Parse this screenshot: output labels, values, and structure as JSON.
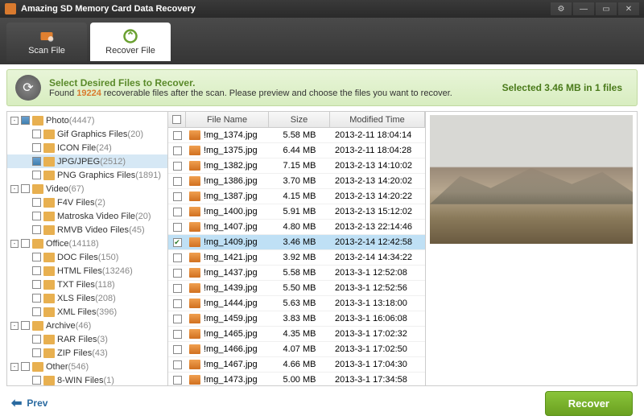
{
  "title": "Amazing SD Memory Card Data Recovery",
  "toolbar": {
    "scan": "Scan File",
    "recover": "Recover File"
  },
  "info": {
    "title": "Select Desired Files to Recover.",
    "found_prefix": "Found ",
    "found_count": "19224",
    "found_suffix": " recoverable files after the scan. Please preview and choose the files you want to recover.",
    "selected": "Selected 3.46 MB in 1 files"
  },
  "tree": [
    {
      "d": 0,
      "exp": "-",
      "chk": "some",
      "label": "Photo",
      "count": "(4447)"
    },
    {
      "d": 1,
      "exp": "",
      "chk": "",
      "label": "Gif Graphics Files",
      "count": "(20)"
    },
    {
      "d": 1,
      "exp": "",
      "chk": "",
      "label": "ICON File",
      "count": "(24)"
    },
    {
      "d": 1,
      "exp": "",
      "chk": "some",
      "label": "JPG/JPEG",
      "count": "(2512)",
      "sel": true
    },
    {
      "d": 1,
      "exp": "",
      "chk": "",
      "label": "PNG Graphics Files",
      "count": "(1891)"
    },
    {
      "d": 0,
      "exp": "-",
      "chk": "",
      "label": "Video",
      "count": "(67)"
    },
    {
      "d": 1,
      "exp": "",
      "chk": "",
      "label": "F4V Files",
      "count": "(2)"
    },
    {
      "d": 1,
      "exp": "",
      "chk": "",
      "label": "Matroska Video File",
      "count": "(20)"
    },
    {
      "d": 1,
      "exp": "",
      "chk": "",
      "label": "RMVB Video Files",
      "count": "(45)"
    },
    {
      "d": 0,
      "exp": "-",
      "chk": "",
      "label": "Office",
      "count": "(14118)"
    },
    {
      "d": 1,
      "exp": "",
      "chk": "",
      "label": "DOC Files",
      "count": "(150)"
    },
    {
      "d": 1,
      "exp": "",
      "chk": "",
      "label": "HTML Files",
      "count": "(13246)"
    },
    {
      "d": 1,
      "exp": "",
      "chk": "",
      "label": "TXT Files",
      "count": "(118)"
    },
    {
      "d": 1,
      "exp": "",
      "chk": "",
      "label": "XLS Files",
      "count": "(208)"
    },
    {
      "d": 1,
      "exp": "",
      "chk": "",
      "label": "XML Files",
      "count": "(396)"
    },
    {
      "d": 0,
      "exp": "-",
      "chk": "",
      "label": "Archive",
      "count": "(46)"
    },
    {
      "d": 1,
      "exp": "",
      "chk": "",
      "label": "RAR Files",
      "count": "(3)"
    },
    {
      "d": 1,
      "exp": "",
      "chk": "",
      "label": "ZIP Files",
      "count": "(43)"
    },
    {
      "d": 0,
      "exp": "-",
      "chk": "",
      "label": "Other",
      "count": "(546)"
    },
    {
      "d": 1,
      "exp": "",
      "chk": "",
      "label": "8-WIN Files",
      "count": "(1)"
    }
  ],
  "grid": {
    "headers": {
      "name": "File Name",
      "size": "Size",
      "time": "Modified Time"
    },
    "rows": [
      {
        "name": "!mg_1374.jpg",
        "size": "5.58 MB",
        "time": "2013-2-11 18:04:14"
      },
      {
        "name": "!mg_1375.jpg",
        "size": "6.44 MB",
        "time": "2013-2-11 18:04:28"
      },
      {
        "name": "!mg_1382.jpg",
        "size": "7.15 MB",
        "time": "2013-2-13 14:10:02"
      },
      {
        "name": "!mg_1386.jpg",
        "size": "3.70 MB",
        "time": "2013-2-13 14:20:02"
      },
      {
        "name": "!mg_1387.jpg",
        "size": "4.15 MB",
        "time": "2013-2-13 14:20:22"
      },
      {
        "name": "!mg_1400.jpg",
        "size": "5.91 MB",
        "time": "2013-2-13 15:12:02"
      },
      {
        "name": "!mg_1407.jpg",
        "size": "4.80 MB",
        "time": "2013-2-13 22:14:46"
      },
      {
        "name": "!mg_1409.jpg",
        "size": "3.46 MB",
        "time": "2013-2-14 12:42:58",
        "chk": true,
        "sel": true
      },
      {
        "name": "!mg_1421.jpg",
        "size": "3.92 MB",
        "time": "2013-2-14 14:34:22"
      },
      {
        "name": "!mg_1437.jpg",
        "size": "5.58 MB",
        "time": "2013-3-1 12:52:08"
      },
      {
        "name": "!mg_1439.jpg",
        "size": "5.50 MB",
        "time": "2013-3-1 12:52:56"
      },
      {
        "name": "!mg_1444.jpg",
        "size": "5.63 MB",
        "time": "2013-3-1 13:18:00"
      },
      {
        "name": "!mg_1459.jpg",
        "size": "3.83 MB",
        "time": "2013-3-1 16:06:08"
      },
      {
        "name": "!mg_1465.jpg",
        "size": "4.35 MB",
        "time": "2013-3-1 17:02:32"
      },
      {
        "name": "!mg_1466.jpg",
        "size": "4.07 MB",
        "time": "2013-3-1 17:02:50"
      },
      {
        "name": "!mg_1467.jpg",
        "size": "4.66 MB",
        "time": "2013-3-1 17:04:30"
      },
      {
        "name": "!mg_1473.jpg",
        "size": "5.00 MB",
        "time": "2013-3-1 17:34:58"
      }
    ]
  },
  "footer": {
    "prev": "Prev",
    "recover": "Recover"
  }
}
